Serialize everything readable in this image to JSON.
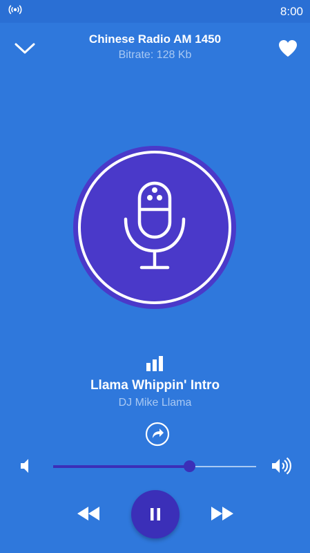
{
  "status_bar": {
    "time": "8:00",
    "icon": "radio-broadcast-icon"
  },
  "header": {
    "station_name": "Chinese Radio AM 1450",
    "bitrate": "Bitrate: 128 Kb",
    "collapse_icon": "chevron-down-icon",
    "favorite_icon": "heart-icon"
  },
  "artwork": {
    "icon": "microphone-icon"
  },
  "now_playing": {
    "equalizer_icon": "equalizer-icon",
    "title": "Llama Whippin' Intro",
    "artist": "DJ Mike Llama",
    "share_icon": "share-icon"
  },
  "volume": {
    "level_fraction": 0.67,
    "low_icon": "volume-low-icon",
    "high_icon": "volume-high-icon"
  },
  "controls": {
    "rewind_icon": "rewind-icon",
    "pause_icon": "pause-icon",
    "forward_icon": "fast-forward-icon"
  },
  "colors": {
    "background": "#2f78dc",
    "accent": "#3b2fb8",
    "artwork_bg": "#4a39c9",
    "secondary_text": "#a9c9f3"
  }
}
